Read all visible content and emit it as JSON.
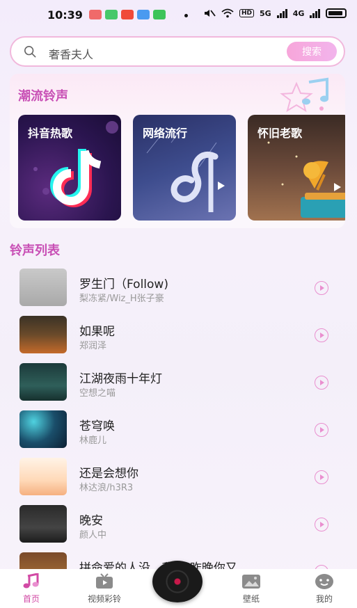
{
  "status_bar": {
    "time": "10:39",
    "net_5g": "5G",
    "net_4g": "4G",
    "hd": "HD"
  },
  "search": {
    "text": "奢香夫人",
    "button_label": "搜索"
  },
  "trend": {
    "title": "潮流铃声",
    "categories": [
      {
        "label": "抖音热歌"
      },
      {
        "label": "网络流行"
      },
      {
        "label": "怀旧老歌"
      }
    ]
  },
  "list": {
    "title": "铃声列表",
    "songs": [
      {
        "name": "罗生门（Follow)",
        "artist": "梨冻紧/Wiz_H张子豪"
      },
      {
        "name": "如果呢",
        "artist": "郑润泽"
      },
      {
        "name": "江湖夜雨十年灯",
        "artist": "空想之喵"
      },
      {
        "name": "苍穹唤",
        "artist": "林鹿儿"
      },
      {
        "name": "还是会想你",
        "artist": "林达浪/h3R3"
      },
      {
        "name": "晚安",
        "artist": "颜人中"
      },
      {
        "name": "拼命爱的人没...我赢(昨晚你又",
        "artist": ""
      }
    ]
  },
  "nav": {
    "home": "首页",
    "video_ring": "视频彩铃",
    "wallpaper": "壁纸",
    "mine": "我的"
  },
  "colors": {
    "accent": "#c84fb5",
    "search_border": "#f1b8dc",
    "play_icon": "#e98fcf"
  }
}
